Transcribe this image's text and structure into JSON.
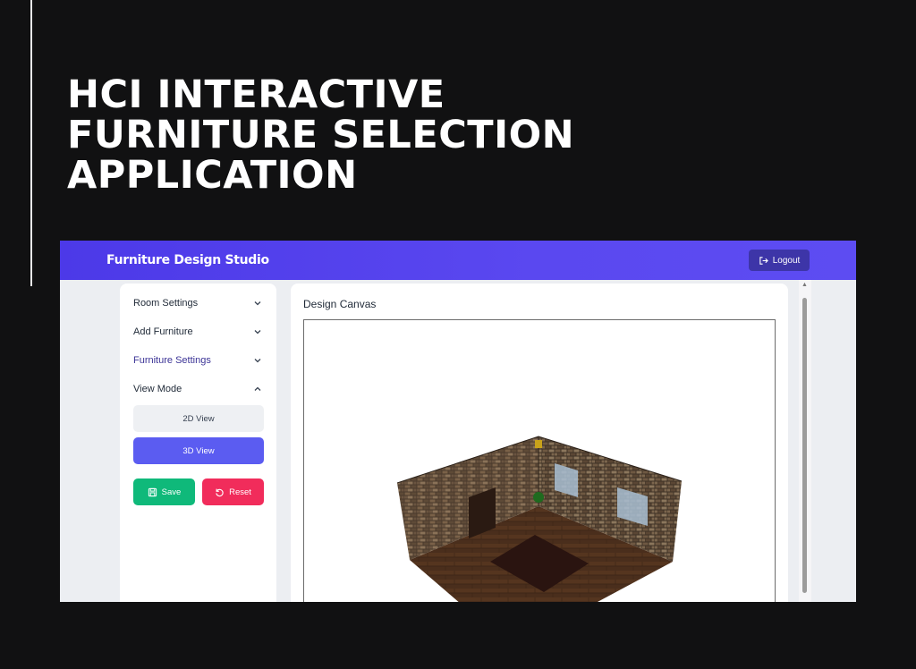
{
  "slide": {
    "title": "HCI INTERACTIVE\nFURNITURE SELECTION\nAPPLICATION"
  },
  "app": {
    "brand": "Furniture Design Studio",
    "logout_label": "Logout"
  },
  "sidebar": {
    "sections": [
      {
        "label": "Room Settings",
        "expanded": false
      },
      {
        "label": "Add Furniture",
        "expanded": false
      },
      {
        "label": "Furniture Settings",
        "expanded": false
      },
      {
        "label": "View Mode",
        "expanded": true
      }
    ],
    "view_2d_label": "2D View",
    "view_3d_label": "3D View",
    "save_label": "Save",
    "reset_label": "Reset"
  },
  "canvas": {
    "title": "Design Canvas",
    "view_mode": "3D View"
  },
  "colors": {
    "header_gradient": [
      "#4c39e8",
      "#5d4cf2"
    ],
    "primary": "#5b5cf1",
    "save": "#0fb97a",
    "reset": "#f12c5b"
  },
  "icons": [
    "logout-icon",
    "chevron-down-icon",
    "chevron-up-icon",
    "save-icon",
    "reset-icon"
  ]
}
